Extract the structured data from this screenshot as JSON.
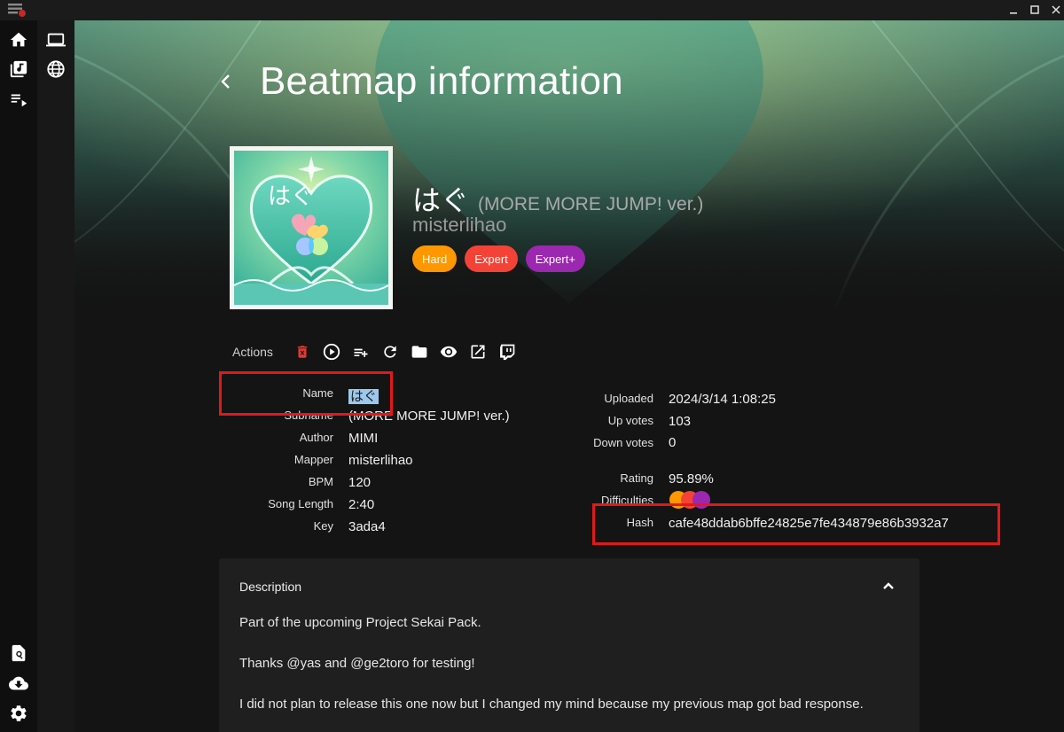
{
  "window": {
    "minimize_glyph": "–",
    "maximize_glyph": "□",
    "close_glyph": "✕"
  },
  "nav": {
    "primary": [
      "home-icon",
      "library-music-icon",
      "playlist-icon"
    ],
    "secondary": [
      "laptop-icon",
      "globe-icon"
    ],
    "bottom": [
      "search-file-icon",
      "cloud-download-icon",
      "settings-icon"
    ]
  },
  "page": {
    "title": "Beatmap information"
  },
  "beatmap": {
    "title": "はぐ",
    "subtitle": "(MORE MORE JUMP! ver.)",
    "mapper": "misterlihao",
    "cover_text": "はぐ",
    "difficulties": [
      {
        "label": "Hard",
        "color": "#ff9800"
      },
      {
        "label": "Expert",
        "color": "#f44336"
      },
      {
        "label": "Expert+",
        "color": "#9c27b0"
      }
    ]
  },
  "actions": {
    "label": "Actions",
    "icons": [
      "delete-icon",
      "play-circle-icon",
      "playlist-add-icon",
      "refresh-icon",
      "folder-icon",
      "preview-eye-icon",
      "open-external-icon",
      "twitch-icon"
    ]
  },
  "details": {
    "left": [
      {
        "label": "Name",
        "value": "はぐ"
      },
      {
        "label": "Subname",
        "value": "(MORE MORE JUMP! ver.)"
      },
      {
        "label": "Author",
        "value": "MIMI"
      },
      {
        "label": "Mapper",
        "value": "misterlihao"
      },
      {
        "label": "BPM",
        "value": "120"
      },
      {
        "label": "Song Length",
        "value": "2:40"
      },
      {
        "label": "Key",
        "value": "3ada4"
      }
    ],
    "right": [
      {
        "label": "Uploaded",
        "value": "2024/3/14 1:08:25"
      },
      {
        "label": "Up votes",
        "value": "103"
      },
      {
        "label": "Down votes",
        "value": "0"
      },
      {
        "label": "Rating",
        "value": "95.89%"
      },
      {
        "label": "Difficulties",
        "value": ""
      },
      {
        "label": "Hash",
        "value": "cafe48ddab6bffe24825e7fe434879e86b3932a7"
      }
    ]
  },
  "description": {
    "header": "Description",
    "lines": [
      "Part of the upcoming Project Sekai Pack.",
      "Thanks @yas and @ge2toro for testing!",
      "I did not plan to release this one now but I changed my mind because my previous map got bad response."
    ]
  },
  "colors": {
    "accent_red": "#e11919",
    "hard": "#ff9800",
    "expert": "#f44336",
    "expert_plus": "#9c27b0",
    "selection": "#9dc8ee"
  }
}
